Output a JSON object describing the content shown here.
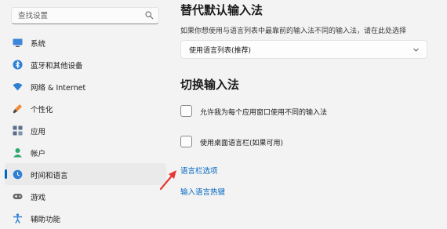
{
  "sidebar": {
    "search": {
      "placeholder": "查找设置"
    },
    "items": [
      {
        "label": "系统",
        "icon": "monitor-icon",
        "active": false
      },
      {
        "label": "蓝牙和其他设备",
        "icon": "bluetooth-icon",
        "active": false
      },
      {
        "label": "网络 & Internet",
        "icon": "wifi-icon",
        "active": false
      },
      {
        "label": "个性化",
        "icon": "paintbrush-icon",
        "active": false
      },
      {
        "label": "应用",
        "icon": "apps-icon",
        "active": false
      },
      {
        "label": "帐户",
        "icon": "person-icon",
        "active": false
      },
      {
        "label": "时间和语言",
        "icon": "globe-clock-icon",
        "active": true
      },
      {
        "label": "游戏",
        "icon": "gamepad-icon",
        "active": false
      },
      {
        "label": "辅助功能",
        "icon": "accessibility-icon",
        "active": false
      }
    ]
  },
  "main": {
    "override_title": "替代默认输入法",
    "override_desc": "如果你想使用与语言列表中最靠前的输入法不同的输入法，请在此处选择",
    "override_dropdown_value": "使用语言列表(推荐)",
    "switch_title": "切换输入法",
    "checkbox_per_app": "允许我为每个应用窗口使用不同的输入法",
    "checkbox_language_bar": "使用桌面语言栏(如果可用)",
    "link_language_bar_options": "语言栏选项",
    "link_input_hotkeys": "输入语言热键"
  },
  "colors": {
    "accent": "#0067c0",
    "annotation_arrow": "#e53935",
    "background": "#f3f3f3"
  }
}
